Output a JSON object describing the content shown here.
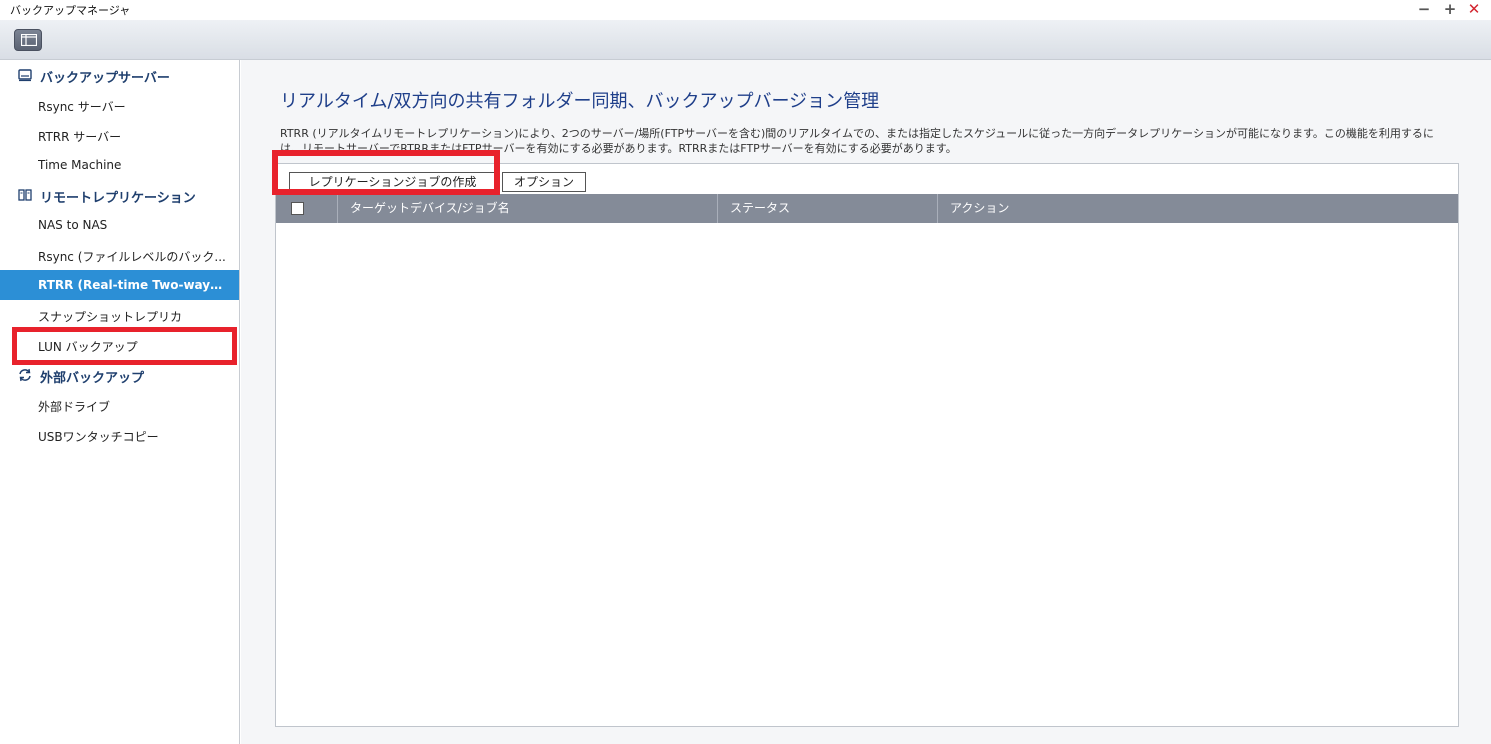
{
  "window": {
    "title": "バックアップマネージャ",
    "controls": {
      "minimize": "−",
      "maximize": "+",
      "close": "✕"
    }
  },
  "sidebar": {
    "groups": [
      {
        "label": "バックアップサーバー",
        "icon": "server-icon",
        "items": [
          {
            "label": "Rsync サーバー"
          },
          {
            "label": "RTRR サーバー"
          },
          {
            "label": "Time Machine"
          }
        ]
      },
      {
        "label": "リモートレプリケーション",
        "icon": "nas-icon",
        "items": [
          {
            "label": "NAS to NAS"
          },
          {
            "label": "Rsync (ファイルレベルのバック..."
          },
          {
            "label": "RTRR (Real-time Two-way Folder ...",
            "active": true
          },
          {
            "label": "スナップショットレプリカ"
          },
          {
            "label": "LUN バックアップ"
          }
        ]
      },
      {
        "label": "外部バックアップ",
        "icon": "sync-icon",
        "items": [
          {
            "label": "外部ドライブ"
          },
          {
            "label": "USBワンタッチコピー"
          }
        ]
      }
    ]
  },
  "main": {
    "title": "リアルタイム/双方向の共有フォルダー同期、バックアップバージョン管理",
    "description": "RTRR (リアルタイムリモートレプリケーション)により、2つのサーバー/場所(FTPサーバーを含む)間のリアルタイムでの、または指定したスケジュールに従った一方向データレプリケーションが可能になります。この機能を利用するには、リモートサーバーでRTRRまたはFTPサーバーを有効にする必要があります。RTRRまたはFTPサーバーを有効にする必要があります。",
    "buttons": {
      "create": "レプリケーションジョブの作成",
      "option": "オプション"
    },
    "table": {
      "columns": [
        "ターゲットデバイス/ジョブ名",
        "ステータス",
        "アクション"
      ]
    }
  },
  "colors": {
    "accent": "#2c8fd6",
    "highlight": "#e8222c",
    "header": "#848b98",
    "title": "#1f3f8a"
  }
}
